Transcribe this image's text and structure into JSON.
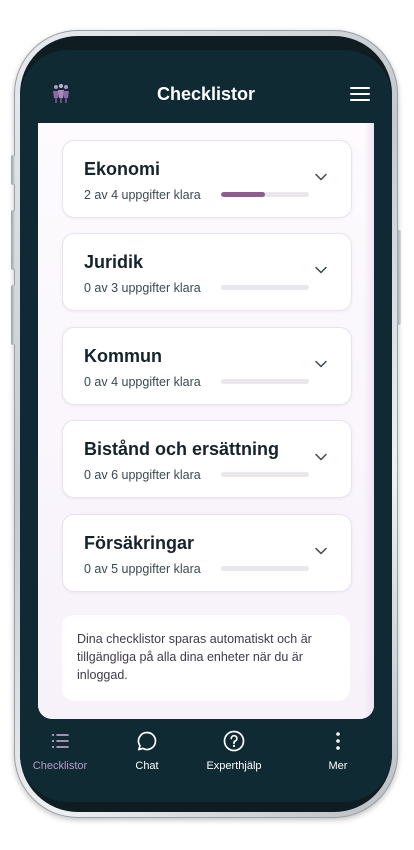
{
  "header": {
    "title": "Checklistor",
    "logo_icon": "people-logo-icon",
    "menu_icon": "hamburger-menu-icon"
  },
  "checklists": [
    {
      "title": "Ekonomi",
      "status": "2 av 4 uppgifter klara",
      "progress": 0.5
    },
    {
      "title": "Juridik",
      "status": "0 av 3 uppgifter klara",
      "progress": 0
    },
    {
      "title": "Kommun",
      "status": "0 av 4 uppgifter klara",
      "progress": 0
    },
    {
      "title": "Bistånd och ersättning",
      "status": "0 av 6 uppgifter klara",
      "progress": 0
    },
    {
      "title": "Försäkringar",
      "status": "0 av 5 uppgifter klara",
      "progress": 0
    }
  ],
  "info": {
    "text": "Dina checklistor sparas automatiskt och är tillgängliga på alla dina enheter när du är inloggad."
  },
  "nav": {
    "items": [
      {
        "label": "Checklistor",
        "icon": "list-icon",
        "active": true
      },
      {
        "label": "Chat",
        "icon": "chat-bubble-icon",
        "active": false
      },
      {
        "label": "Experthjälp",
        "icon": "help-circle-icon",
        "active": false
      },
      {
        "label": "Mer",
        "icon": "more-vertical-icon",
        "active": false
      }
    ]
  },
  "colors": {
    "header_bg": "#0f2a33",
    "accent": "#8e5c8f",
    "nav_active": "#b99cc6",
    "progress_track": "#e9e7ec"
  }
}
